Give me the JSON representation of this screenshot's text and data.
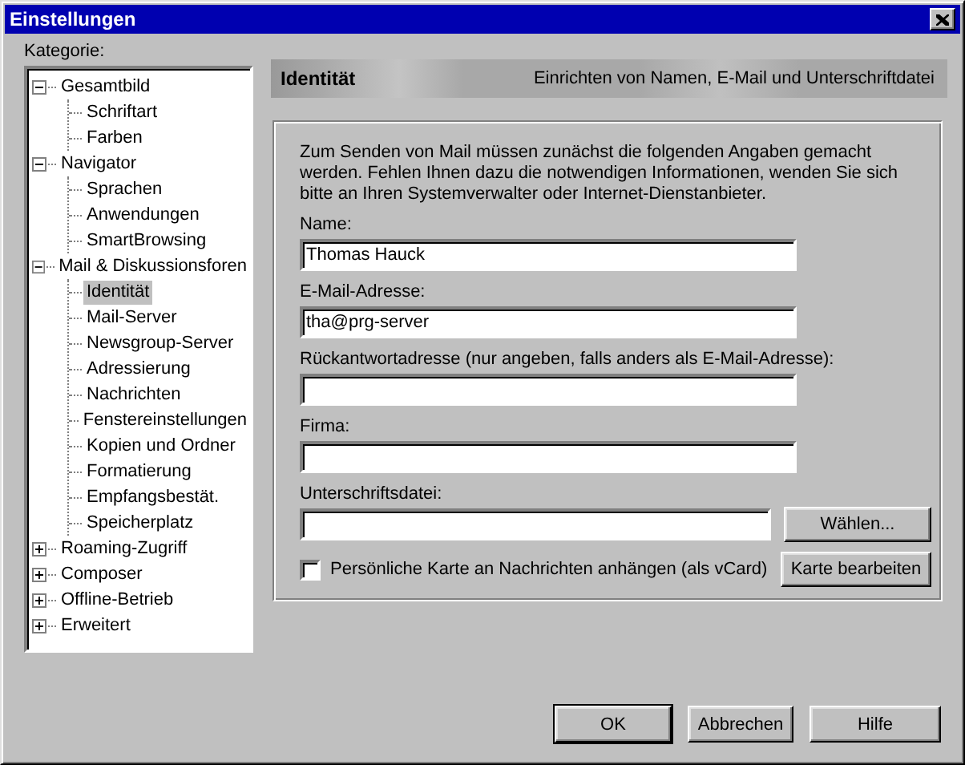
{
  "window": {
    "title": "Einstellungen"
  },
  "category_label": "Kategorie:",
  "tree": [
    {
      "label": "Gesamtbild",
      "expanded": true,
      "selected": false,
      "children": [
        {
          "label": "Schriftart",
          "selected": false
        },
        {
          "label": "Farben",
          "selected": false
        }
      ]
    },
    {
      "label": "Navigator",
      "expanded": true,
      "selected": false,
      "children": [
        {
          "label": "Sprachen",
          "selected": false
        },
        {
          "label": "Anwendungen",
          "selected": false
        },
        {
          "label": "SmartBrowsing",
          "selected": false
        }
      ]
    },
    {
      "label": "Mail & Diskussionsforen",
      "expanded": true,
      "selected": false,
      "children": [
        {
          "label": "Identität",
          "selected": true
        },
        {
          "label": "Mail-Server",
          "selected": false
        },
        {
          "label": "Newsgroup-Server",
          "selected": false
        },
        {
          "label": "Adressierung",
          "selected": false
        },
        {
          "label": "Nachrichten",
          "selected": false
        },
        {
          "label": "Fenstereinstellungen",
          "selected": false
        },
        {
          "label": "Kopien und Ordner",
          "selected": false
        },
        {
          "label": "Formatierung",
          "selected": false
        },
        {
          "label": "Empfangsbestät.",
          "selected": false
        },
        {
          "label": "Speicherplatz",
          "selected": false
        }
      ]
    },
    {
      "label": "Roaming-Zugriff",
      "expanded": false,
      "selected": false
    },
    {
      "label": "Composer",
      "expanded": false,
      "selected": false
    },
    {
      "label": "Offline-Betrieb",
      "expanded": false,
      "selected": false
    },
    {
      "label": "Erweitert",
      "expanded": false,
      "selected": false
    }
  ],
  "header": {
    "title": "Identität",
    "description": "Einrichten von Namen, E-Mail und Unterschriftdatei"
  },
  "group": {
    "intro": "Zum Senden von Mail müssen zunächst die folgenden Angaben gemacht werden. Fehlen Ihnen dazu die notwendigen Informationen, wenden Sie sich bitte an Ihren Systemverwalter oder Internet-Dienstanbieter.",
    "fields": [
      {
        "kind": "text",
        "label": "Name:",
        "value": "Thomas Hauck"
      },
      {
        "kind": "text",
        "label": "E-Mail-Adresse:",
        "value": "tha@prg-server"
      },
      {
        "kind": "text",
        "label": "Rückantwortadresse (nur angeben, falls anders als E-Mail-Adresse):"
      },
      {
        "kind": "text",
        "label": "Firma:"
      },
      {
        "kind": "file",
        "label": "Unterschriftsdatei:",
        "button": "Wählen..."
      }
    ],
    "checkbox": {
      "label": "Persönliche Karte an Nachrichten anhängen (als vCard)",
      "checked": false
    },
    "card_button": "Karte bearbeiten"
  },
  "buttons": [
    {
      "label": "OK",
      "default": true
    },
    {
      "label": "Abbrechen",
      "default": false
    },
    {
      "label": "Hilfe",
      "default": false
    }
  ]
}
